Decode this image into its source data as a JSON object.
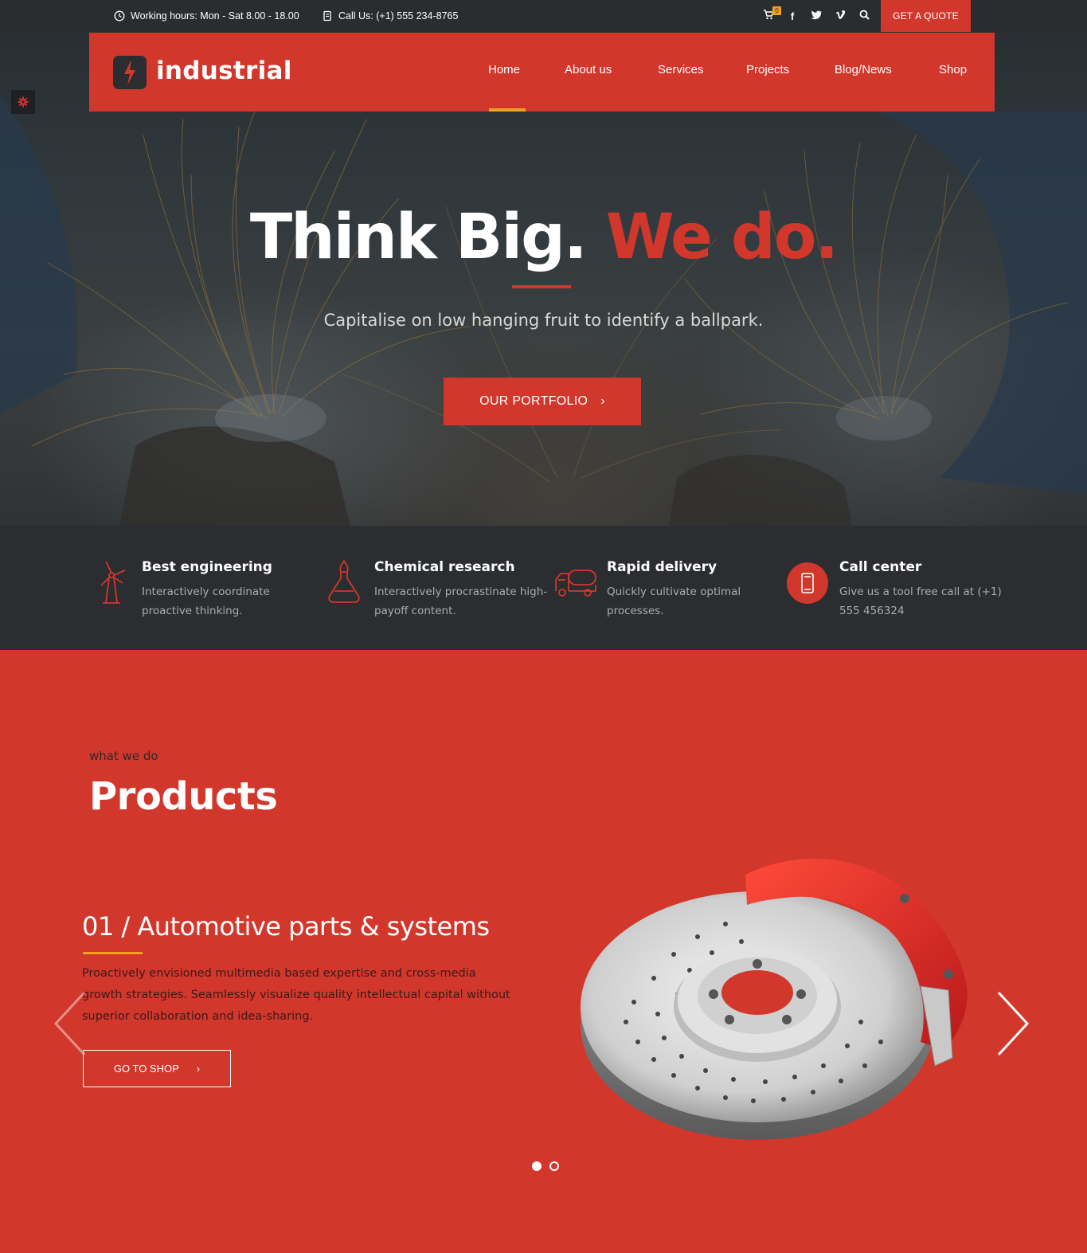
{
  "topbar": {
    "working_hours": "Working hours:  Mon - Sat 8.00 - 18.00",
    "call_us": "Call Us:  (+1) 555 234-8765",
    "cart_count": "0",
    "social": [
      "f",
      "t",
      "v"
    ],
    "quote_button": "GET A QUOTE"
  },
  "brand": {
    "name": "industrial"
  },
  "nav": {
    "items": [
      "Home",
      "About us",
      "Services",
      "Projects",
      "Blog/News",
      "Shop"
    ],
    "active": "Home"
  },
  "hero": {
    "title_part1": "Think Big.",
    "title_part2": "We do.",
    "subtitle": "Capitalise on low hanging fruit to identify a ballpark.",
    "button": "OUR PORTFOLIO"
  },
  "features": [
    {
      "icon": "windmill-icon",
      "title": "Best engineering",
      "desc": "Interactively coordinate proactive thinking."
    },
    {
      "icon": "flask-icon",
      "title": "Chemical research",
      "desc": "Interactively procrastinate high-payoff content."
    },
    {
      "icon": "truck-icon",
      "title": "Rapid delivery",
      "desc": "Quickly cultivate optimal processes."
    },
    {
      "icon": "phone-icon",
      "title": "Call center",
      "desc": "Give us a tool free call at (+1) 555 456324"
    }
  ],
  "products": {
    "eyebrow": "what we do",
    "title": "Products",
    "slide": {
      "title": "01 / Automotive parts & systems",
      "desc": "Proactively envisioned multimedia based expertise and cross-media growth strategies. Seamlessly visualize quality intellectual capital without superior collaboration and idea-sharing.",
      "button": "GO TO SHOP"
    },
    "slide_count": 2,
    "active_slide": 1
  },
  "colors": {
    "accent": "#d2372c",
    "highlight": "#f0a11c",
    "dark": "#2b2d30"
  }
}
